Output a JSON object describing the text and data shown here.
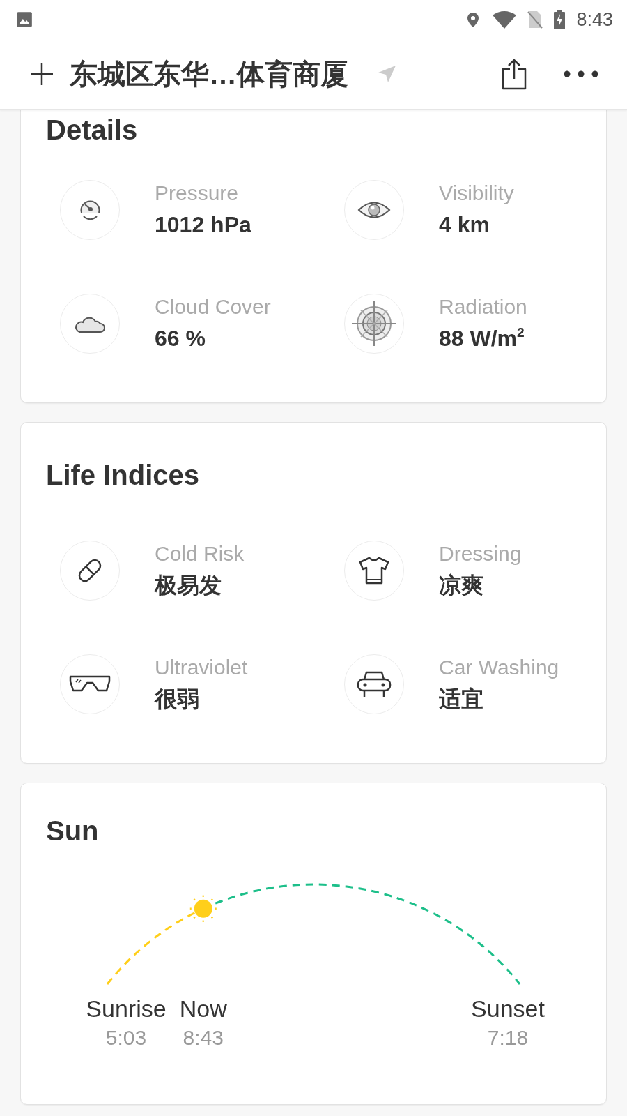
{
  "status_bar": {
    "time": "8:43"
  },
  "header": {
    "title": "东城区东华…体育商厦"
  },
  "details": {
    "title": "Details",
    "items": [
      {
        "kind": "pressure",
        "label": "Pressure",
        "value": "1012 hPa"
      },
      {
        "kind": "visibility",
        "label": "Visibility",
        "value": "4 km"
      },
      {
        "kind": "cloud",
        "label": "Cloud Cover",
        "value": "66 %"
      },
      {
        "kind": "radiation",
        "label": "Radiation",
        "value": "88 W/m$^{2}$"
      }
    ]
  },
  "life_indices": {
    "title": "Life Indices",
    "items": [
      {
        "kind": "cold",
        "label": "Cold Risk",
        "value": "极易发"
      },
      {
        "kind": "dressing",
        "label": "Dressing",
        "value": "凉爽"
      },
      {
        "kind": "uv",
        "label": "Ultraviolet",
        "value": "很弱"
      },
      {
        "kind": "car",
        "label": "Car Washing",
        "value": "适宜"
      }
    ]
  },
  "sun": {
    "title": "Sun",
    "level": 0.26,
    "sunrise": {
      "label": "Sunrise",
      "time": "5:03"
    },
    "now": {
      "label": "Now",
      "time": "8:43"
    },
    "sunset": {
      "label": "Sunset",
      "time": "7:18"
    }
  }
}
